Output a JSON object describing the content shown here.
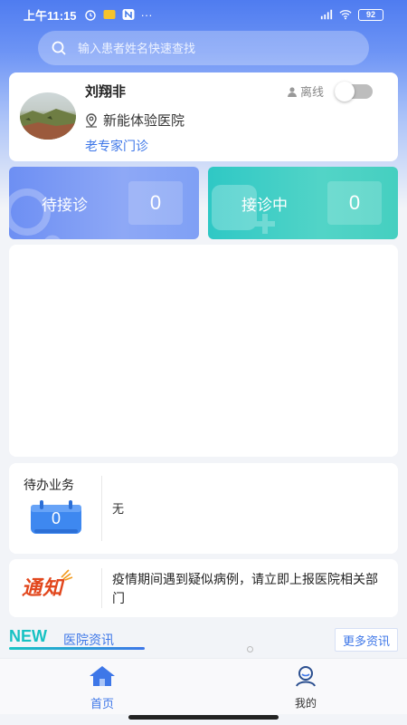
{
  "status_bar": {
    "time": "上午11:15",
    "battery": "92"
  },
  "search": {
    "placeholder": "输入患者姓名快速查找"
  },
  "doctor": {
    "name": "刘翔非",
    "status_label": "离线",
    "hospital": "新能体验医院",
    "department": "老专家门诊"
  },
  "stats": [
    {
      "label": "待接诊",
      "count": "0"
    },
    {
      "label": "接诊中",
      "count": "0"
    }
  ],
  "todo": {
    "title": "待办业务",
    "badge_count": "0",
    "content": "无"
  },
  "notice": {
    "logo_text": "通知",
    "text": "疫情期间遇到疑似病例，请立即上报医院相关部门"
  },
  "news": {
    "new_tag": "NEW",
    "title": "医院资讯",
    "more_label": "更多资讯"
  },
  "tabbar": {
    "home_label": "首页",
    "mine_label": "我的"
  },
  "colors": {
    "accent": "#3e77e8",
    "teal": "#2fc8c5",
    "notice_red": "#e2471d"
  }
}
